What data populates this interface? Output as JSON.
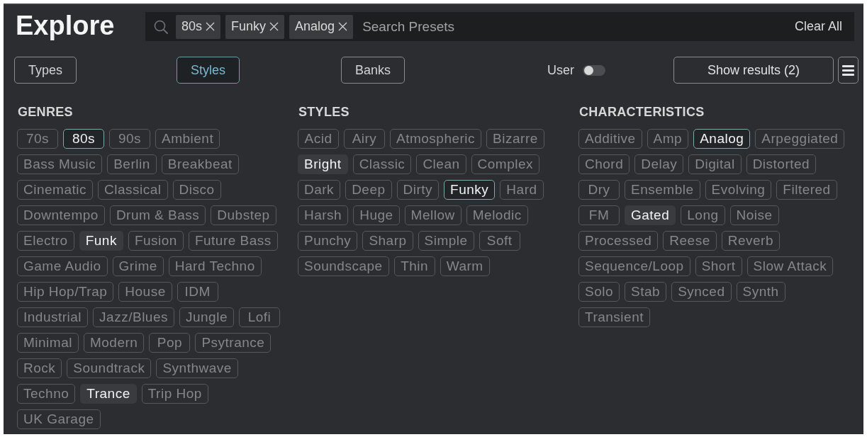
{
  "header": {
    "title": "Explore"
  },
  "search": {
    "chips": [
      {
        "label": "80s"
      },
      {
        "label": "Funky"
      },
      {
        "label": "Analog"
      }
    ],
    "placeholder": "Search Presets",
    "clear_label": "Clear All"
  },
  "tabs": [
    {
      "label": "Types",
      "selected": false
    },
    {
      "label": "Styles",
      "selected": true
    },
    {
      "label": "Banks",
      "selected": false
    }
  ],
  "user_toggle": {
    "label": "User",
    "on": false
  },
  "show_results": "Show results (2)",
  "sections": [
    {
      "heading": "GENRES",
      "tags": [
        {
          "label": "70s",
          "selected": false,
          "highlighted": false
        },
        {
          "label": "80s",
          "selected": true,
          "highlighted": false
        },
        {
          "label": "90s",
          "selected": false,
          "highlighted": false
        },
        {
          "label": "Ambient",
          "selected": false,
          "highlighted": false
        },
        {
          "label": "Bass Music",
          "selected": false,
          "highlighted": false
        },
        {
          "label": "Berlin",
          "selected": false,
          "highlighted": false
        },
        {
          "label": "Breakbeat",
          "selected": false,
          "highlighted": false
        },
        {
          "label": "Cinematic",
          "selected": false,
          "highlighted": false
        },
        {
          "label": "Classical",
          "selected": false,
          "highlighted": false
        },
        {
          "label": "Disco",
          "selected": false,
          "highlighted": false
        },
        {
          "label": "Downtempo",
          "selected": false,
          "highlighted": false
        },
        {
          "label": "Drum & Bass",
          "selected": false,
          "highlighted": false
        },
        {
          "label": "Dubstep",
          "selected": false,
          "highlighted": false
        },
        {
          "label": "Electro",
          "selected": false,
          "highlighted": false
        },
        {
          "label": "Funk",
          "selected": false,
          "highlighted": true
        },
        {
          "label": "Fusion",
          "selected": false,
          "highlighted": false
        },
        {
          "label": "Future Bass",
          "selected": false,
          "highlighted": false
        },
        {
          "label": "Game Audio",
          "selected": false,
          "highlighted": false
        },
        {
          "label": "Grime",
          "selected": false,
          "highlighted": false
        },
        {
          "label": "Hard Techno",
          "selected": false,
          "highlighted": false
        },
        {
          "label": "Hip Hop/Trap",
          "selected": false,
          "highlighted": false
        },
        {
          "label": "House",
          "selected": false,
          "highlighted": false
        },
        {
          "label": "IDM",
          "selected": false,
          "highlighted": false
        },
        {
          "label": "Industrial",
          "selected": false,
          "highlighted": false
        },
        {
          "label": "Jazz/Blues",
          "selected": false,
          "highlighted": false
        },
        {
          "label": "Jungle",
          "selected": false,
          "highlighted": false
        },
        {
          "label": "Lofi",
          "selected": false,
          "highlighted": false
        },
        {
          "label": "Minimal",
          "selected": false,
          "highlighted": false
        },
        {
          "label": "Modern",
          "selected": false,
          "highlighted": false
        },
        {
          "label": "Pop",
          "selected": false,
          "highlighted": false
        },
        {
          "label": "Psytrance",
          "selected": false,
          "highlighted": false
        },
        {
          "label": "Rock",
          "selected": false,
          "highlighted": false
        },
        {
          "label": "Soundtrack",
          "selected": false,
          "highlighted": false
        },
        {
          "label": "Synthwave",
          "selected": false,
          "highlighted": false
        },
        {
          "label": "Techno",
          "selected": false,
          "highlighted": false
        },
        {
          "label": "Trance",
          "selected": false,
          "highlighted": true
        },
        {
          "label": "Trip Hop",
          "selected": false,
          "highlighted": false
        },
        {
          "label": "UK Garage",
          "selected": false,
          "highlighted": false
        }
      ]
    },
    {
      "heading": "STYLES",
      "tags": [
        {
          "label": "Acid",
          "selected": false,
          "highlighted": false
        },
        {
          "label": "Airy",
          "selected": false,
          "highlighted": false
        },
        {
          "label": "Atmospheric",
          "selected": false,
          "highlighted": false
        },
        {
          "label": "Bizarre",
          "selected": false,
          "highlighted": false
        },
        {
          "label": "Bright",
          "selected": false,
          "highlighted": true
        },
        {
          "label": "Classic",
          "selected": false,
          "highlighted": false
        },
        {
          "label": "Clean",
          "selected": false,
          "highlighted": false
        },
        {
          "label": "Complex",
          "selected": false,
          "highlighted": false
        },
        {
          "label": "Dark",
          "selected": false,
          "highlighted": false
        },
        {
          "label": "Deep",
          "selected": false,
          "highlighted": false
        },
        {
          "label": "Dirty",
          "selected": false,
          "highlighted": false
        },
        {
          "label": "Funky",
          "selected": true,
          "highlighted": false
        },
        {
          "label": "Hard",
          "selected": false,
          "highlighted": false
        },
        {
          "label": "Harsh",
          "selected": false,
          "highlighted": false
        },
        {
          "label": "Huge",
          "selected": false,
          "highlighted": false
        },
        {
          "label": "Mellow",
          "selected": false,
          "highlighted": false
        },
        {
          "label": "Melodic",
          "selected": false,
          "highlighted": false
        },
        {
          "label": "Punchy",
          "selected": false,
          "highlighted": false
        },
        {
          "label": "Sharp",
          "selected": false,
          "highlighted": false
        },
        {
          "label": "Simple",
          "selected": false,
          "highlighted": false
        },
        {
          "label": "Soft",
          "selected": false,
          "highlighted": false
        },
        {
          "label": "Soundscape",
          "selected": false,
          "highlighted": false
        },
        {
          "label": "Thin",
          "selected": false,
          "highlighted": false
        },
        {
          "label": "Warm",
          "selected": false,
          "highlighted": false
        }
      ]
    },
    {
      "heading": "CHARACTERISTICS",
      "tags": [
        {
          "label": "Additive",
          "selected": false,
          "highlighted": false
        },
        {
          "label": "Amp",
          "selected": false,
          "highlighted": false
        },
        {
          "label": "Analog",
          "selected": true,
          "highlighted": false
        },
        {
          "label": "Arpeggiated",
          "selected": false,
          "highlighted": false
        },
        {
          "label": "Chord",
          "selected": false,
          "highlighted": false
        },
        {
          "label": "Delay",
          "selected": false,
          "highlighted": false
        },
        {
          "label": "Digital",
          "selected": false,
          "highlighted": false
        },
        {
          "label": "Distorted",
          "selected": false,
          "highlighted": false
        },
        {
          "label": "Dry",
          "selected": false,
          "highlighted": false
        },
        {
          "label": "Ensemble",
          "selected": false,
          "highlighted": false
        },
        {
          "label": "Evolving",
          "selected": false,
          "highlighted": false
        },
        {
          "label": "Filtered",
          "selected": false,
          "highlighted": false
        },
        {
          "label": "FM",
          "selected": false,
          "highlighted": false
        },
        {
          "label": "Gated",
          "selected": false,
          "highlighted": true
        },
        {
          "label": "Long",
          "selected": false,
          "highlighted": false
        },
        {
          "label": "Noise",
          "selected": false,
          "highlighted": false
        },
        {
          "label": "Processed",
          "selected": false,
          "highlighted": false
        },
        {
          "label": "Reese",
          "selected": false,
          "highlighted": false
        },
        {
          "label": "Reverb",
          "selected": false,
          "highlighted": false
        },
        {
          "label": "Sequence/Loop",
          "selected": false,
          "highlighted": false
        },
        {
          "label": "Short",
          "selected": false,
          "highlighted": false
        },
        {
          "label": "Slow Attack",
          "selected": false,
          "highlighted": false
        },
        {
          "label": "Solo",
          "selected": false,
          "highlighted": false
        },
        {
          "label": "Stab",
          "selected": false,
          "highlighted": false
        },
        {
          "label": "Synced",
          "selected": false,
          "highlighted": false
        },
        {
          "label": "Synth",
          "selected": false,
          "highlighted": false
        },
        {
          "label": "Transient",
          "selected": false,
          "highlighted": false
        }
      ]
    }
  ]
}
